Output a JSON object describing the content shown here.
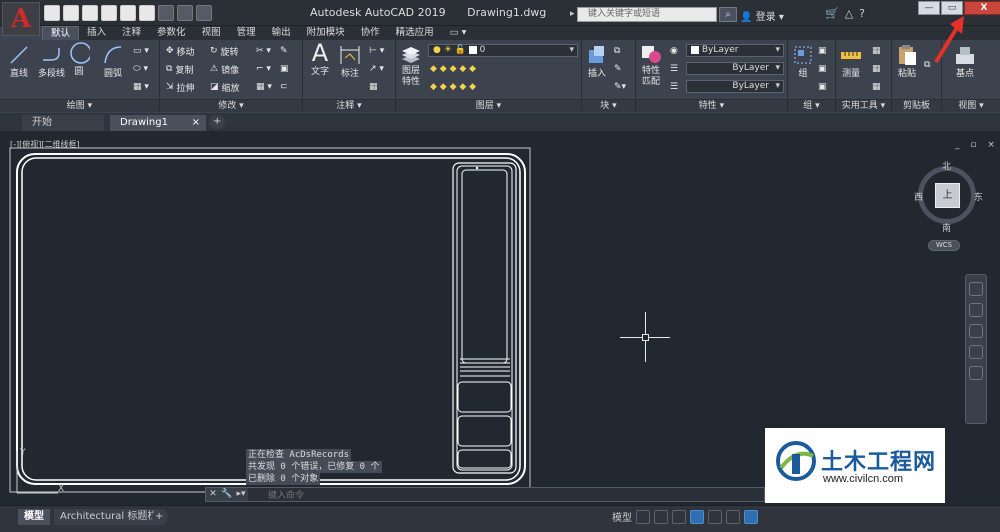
{
  "window": {
    "app_name": "Autodesk AutoCAD 2019",
    "doc_name": "Drawing1.dwg",
    "logo_letter": "A",
    "search_placeholder": "键入关键字或短语",
    "login": "登录",
    "minimize": "—",
    "restore": "▭",
    "close": "X"
  },
  "ribbon_tabs": [
    "默认",
    "插入",
    "注释",
    "参数化",
    "视图",
    "管理",
    "输出",
    "附加模块",
    "协作",
    "精选应用",
    "▭ ▾"
  ],
  "panels": {
    "draw": {
      "title": "绘图 ▾",
      "line": "直线",
      "polyline": "多段线",
      "circle": "圆",
      "arc": "圆弧"
    },
    "modify": {
      "title": "修改 ▾",
      "move": "移动",
      "rotate": "旋转",
      "copy": "复制",
      "mirror": "镜像",
      "stretch": "拉伸",
      "scale": "缩放"
    },
    "annotation": {
      "title": "注释 ▾",
      "text": "文字",
      "dimension": "标注"
    },
    "layers": {
      "title": "图层 ▾",
      "layer_props": "图层\n特性",
      "current_layer": "0"
    },
    "block": {
      "title": "块 ▾",
      "insert": "插入"
    },
    "properties": {
      "title": "特性 ▾",
      "match": "特性\n匹配",
      "color": "ByLayer",
      "linetype": "ByLayer",
      "lineweight": "ByLayer"
    },
    "groups": {
      "title": "组 ▾",
      "group": "组"
    },
    "utilities": {
      "title": "实用工具 ▾",
      "measure": "测量"
    },
    "clipboard": {
      "title": "剪贴板",
      "paste": "粘贴"
    },
    "view": {
      "title": "视图 ▾",
      "base": "基点"
    }
  },
  "file_tabs": {
    "start": "开始",
    "drawing": "Drawing1",
    "close": "×",
    "plus": "+"
  },
  "canvas": {
    "viewport_label": "[-][俯视][二维线框]",
    "window_controls": "_ ▫ ×",
    "viewcube": {
      "north": "北",
      "south": "南",
      "east": "东",
      "west": "西",
      "face": "上",
      "wcs": "WCS"
    }
  },
  "command": {
    "history": [
      "正在检查 AcDsRecords",
      "共发现 0 个错误，已修复 0 个",
      "已删除 0 个对象"
    ],
    "placeholder": "键入命令"
  },
  "status": {
    "model": "模型",
    "layout": "Architectural 标题栏",
    "plus": "+",
    "model_right": "模型"
  },
  "watermark": {
    "title": "土木工程网",
    "url": "www.civilcn.com"
  },
  "colors": {
    "accent_red": "#c9463d",
    "canvas_bg": "#212830",
    "ribbon_bg": "#3d434e",
    "watermark_blue": "#1c5a9e"
  }
}
